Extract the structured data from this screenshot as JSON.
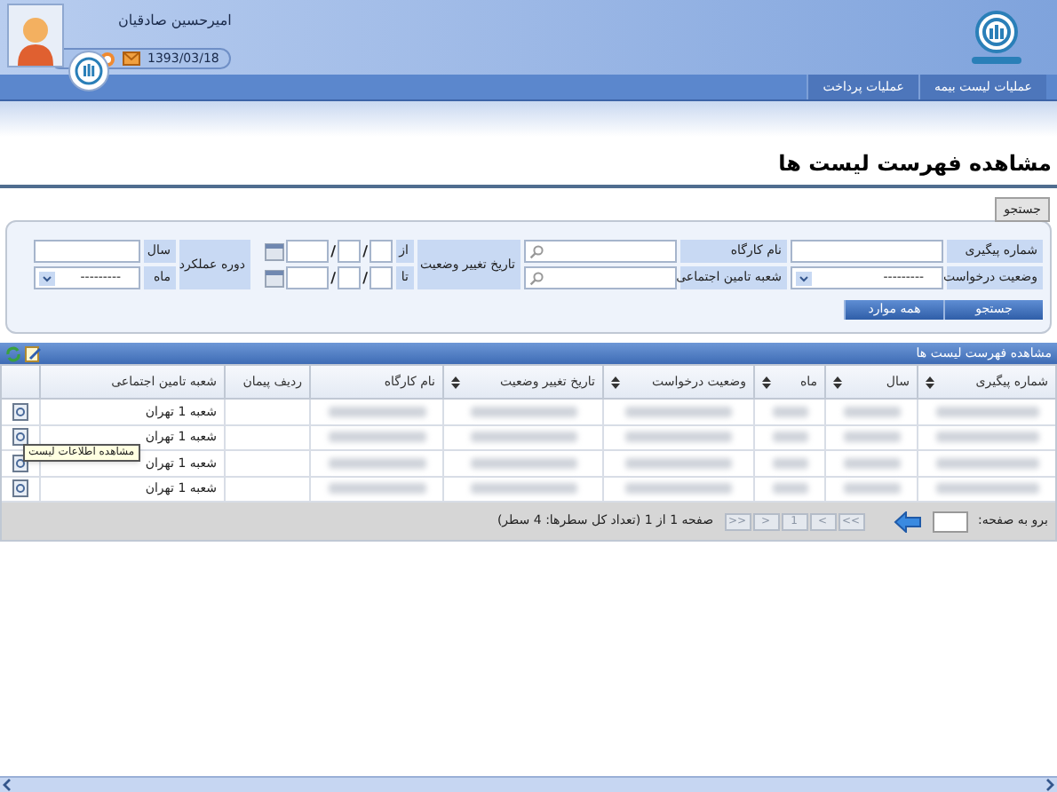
{
  "header": {
    "user_name": "امیرحسین صادقیان",
    "date": "1393/03/18"
  },
  "nav_tabs": [
    {
      "label": "عملیات لیست بیمه"
    },
    {
      "label": "عملیات پرداخت"
    }
  ],
  "page_title": "مشاهده فهرست لیست ها",
  "search": {
    "tab_label": "جستجو",
    "tracking_number": {
      "label": "شماره پیگیری"
    },
    "workshop_name": {
      "label": "نام کارگاه"
    },
    "request_status": {
      "label": "وضعیت درخواست",
      "value": "---------"
    },
    "branch": {
      "label": "شعبه تامین اجتماعی"
    },
    "status_change_date": {
      "label": "تاریخ تغییر وضعیت",
      "from_label": "از",
      "to_label": "تا",
      "separator": "/"
    },
    "performance_period": {
      "label": "دوره عملکرد",
      "year_label": "سال",
      "month_label": "ماه",
      "month_value": "---------"
    },
    "buttons": [
      "جستجو",
      "همه موارد"
    ]
  },
  "grid": {
    "title": "مشاهده فهرست لیست ها",
    "columns": [
      {
        "label": "شماره پیگیری",
        "sortable": true,
        "kind": "blurred"
      },
      {
        "label": "سال",
        "sortable": true,
        "kind": "blurred"
      },
      {
        "label": "ماه",
        "sortable": true,
        "kind": "blurred"
      },
      {
        "label": "وضعیت درخواست",
        "sortable": true,
        "kind": "blurred"
      },
      {
        "label": "تاریخ تغییر وضعیت",
        "sortable": true,
        "kind": "blurred"
      },
      {
        "label": "نام کارگاه",
        "sortable": false,
        "kind": "blurred"
      },
      {
        "label": "ردیف پیمان",
        "sortable": false,
        "kind": "empty"
      },
      {
        "label": "شعبه تامین اجتماعی",
        "sortable": false,
        "kind": "text"
      }
    ],
    "rows": [
      {
        "branch": "شعبه 1 تهران"
      },
      {
        "branch": "شعبه 1 تهران",
        "tooltip": "مشاهده اطلاعات لیست"
      },
      {
        "branch": "شعبه 1 تهران"
      },
      {
        "branch": "شعبه 1 تهران"
      }
    ],
    "pager": {
      "goto_label": "برو به صفحه:",
      "buttons": [
        ">>",
        ">",
        "1",
        "<",
        "<<"
      ],
      "summary": "صفحه 1 از 1 (تعداد کل سطرها: 4 سطر)"
    }
  }
}
